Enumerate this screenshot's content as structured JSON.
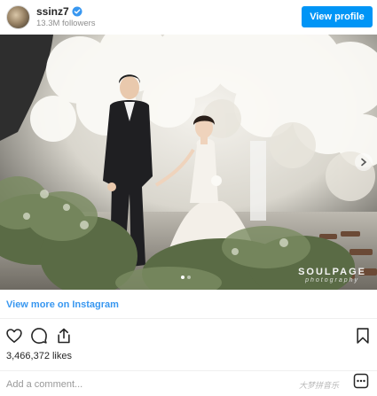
{
  "header": {
    "username": "ssinz7",
    "followers": "13.3M followers",
    "view_profile_label": "View profile",
    "verified_icon": "verified-badge-icon",
    "accent_color": "#0095f6"
  },
  "post": {
    "image_watermark": {
      "brand": "SOULPAGE",
      "sub": "photography"
    },
    "carousel": {
      "total": 2,
      "current": 1
    }
  },
  "view_more_label": "View more on Instagram",
  "actions": {
    "like_icon": "heart-icon",
    "comment_icon": "comment-icon",
    "share_icon": "share-icon",
    "save_icon": "bookmark-icon"
  },
  "likes_text": "3,466,372 likes",
  "comment_placeholder": "Add a comment...",
  "corner_watermark": "大梦拼音乐"
}
